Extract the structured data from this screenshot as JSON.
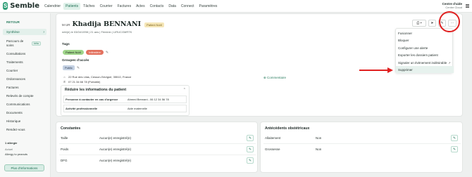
{
  "app": {
    "logo_mark": "S",
    "logo_text": "Semble"
  },
  "nav": {
    "items": [
      "Calendrier",
      "Patients",
      "Tâches",
      "Courrier",
      "Factures",
      "Actes",
      "Contacts",
      "Data",
      "Connect",
      "Paramètres"
    ],
    "active": "Patients"
  },
  "center": {
    "name": "Centre d'aide",
    "sub": "Centre Cloud"
  },
  "sidebar": {
    "back": "RETOUR",
    "items": [
      "Synthèse",
      "Parcours de soins",
      "Consultations",
      "Traitements",
      "Courrier",
      "Ordonnances",
      "Factures",
      "Relevés de compte",
      "Communications",
      "Documents",
      "Historique",
      "Rendez-vous"
    ],
    "beta": "bêta",
    "allergy_title": "1 allergie",
    "allergy_label": "Actuel",
    "allergy_value": "Allergy to peanuts",
    "more_info": "Plus d'informations"
  },
  "patient": {
    "civility": "M UR",
    "name": "Khadija BENNANI",
    "badge": "Patient NuVi",
    "meta": "néé(e) le 03/04/1998  |  21 ans  |  Féminin  |  LIRUCGMRTK",
    "tags_label": "Tags",
    "tags": [
      "Patient NuVi",
      "Infirmière"
    ],
    "groups_label": "Groupes d'accès",
    "group_value": "Public",
    "address": "22 Rue des Lilas, Cesson-Sévigné, 35510, France",
    "phone": "07 21 34 66 78 (Portable)",
    "comment": "Commentaire"
  },
  "actions": {
    "print": "⎙ ▾",
    "send": "➤",
    "edit": "✎",
    "more": "⋯"
  },
  "reduce": {
    "title": "Réduire les informations du patient",
    "rows": [
      {
        "k": "Personne à contacter en cas d'urgence",
        "v": "Ahmed Bennani - 06 12 34 56 78"
      },
      {
        "k": "Activité professionnelle",
        "v": "Aide maternelle"
      }
    ]
  },
  "dropdown": {
    "items": [
      "Fusionner",
      "Bloquer",
      "Configurer une alerte",
      "Exporter les dossiers patient",
      "Signaler un évènement indésirable",
      "Supprimer"
    ],
    "highlighted": "Supprimer"
  },
  "constantes": {
    "title": "Constantes",
    "rows": [
      {
        "k": "Taille",
        "v": "Aucun(e) enregistré(e)"
      },
      {
        "k": "Poids",
        "v": "Aucun(e) enregistré(e)"
      },
      {
        "k": "DFG",
        "v": "Aucun(e) enregistré(e)"
      }
    ]
  },
  "obstetric": {
    "title": "Antécédents obstétricaux",
    "rows": [
      {
        "k": "Allaitement",
        "v": "Non"
      },
      {
        "k": "Grossesse",
        "v": "Non"
      }
    ]
  },
  "colors": {
    "brand": "#2e9e77",
    "annotation": "#e02020",
    "highlight": "#e7f2ee"
  }
}
